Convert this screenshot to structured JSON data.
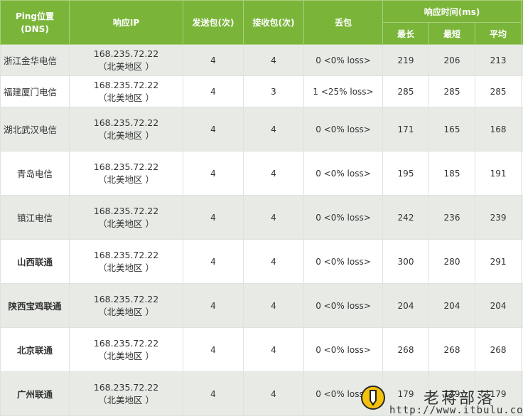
{
  "header": {
    "location": [
      "Ping位置",
      "(DNS)"
    ],
    "ip": "响应IP",
    "sent": "发送包(次)",
    "received": "接收包(次)",
    "lost": "丢包",
    "response_time": "响应时间(ms)",
    "max": "最长",
    "min": "最短",
    "avg": "平均"
  },
  "rows": [
    {
      "location": "浙江金华电信",
      "ip": "168.235.72.22",
      "region": "（北美地区 ）",
      "sent": "4",
      "received": "4",
      "lost": "0 <0% loss>",
      "max": "219",
      "min": "206",
      "avg": "213",
      "align": "left",
      "bold": false
    },
    {
      "location": "福建厦门电信",
      "ip": "168.235.72.22",
      "region": "（北美地区 ）",
      "sent": "4",
      "received": "3",
      "lost": "1 <25% loss>",
      "max": "285",
      "min": "285",
      "avg": "285",
      "align": "left",
      "bold": false
    },
    {
      "location": "湖北武汉电信",
      "ip": "168.235.72.22",
      "region": "（北美地区 ）",
      "sent": "4",
      "received": "4",
      "lost": "0 <0% loss>",
      "max": "171",
      "min": "165",
      "avg": "168",
      "align": "left",
      "bold": false
    },
    {
      "location": "青岛电信",
      "ip": "168.235.72.22",
      "region": "（北美地区 ）",
      "sent": "4",
      "received": "4",
      "lost": "0 <0% loss>",
      "max": "195",
      "min": "185",
      "avg": "191",
      "align": "center",
      "bold": false
    },
    {
      "location": "镇江电信",
      "ip": "168.235.72.22",
      "region": "（北美地区 ）",
      "sent": "4",
      "received": "4",
      "lost": "0 <0% loss>",
      "max": "242",
      "min": "236",
      "avg": "239",
      "align": "center",
      "bold": false
    },
    {
      "location": "山西联通",
      "ip": "168.235.72.22",
      "region": "（北美地区 ）",
      "sent": "4",
      "received": "4",
      "lost": "0 <0% loss>",
      "max": "300",
      "min": "280",
      "avg": "291",
      "align": "center",
      "bold": true
    },
    {
      "location": "陕西宝鸡联通",
      "ip": "168.235.72.22",
      "region": "（北美地区 ）",
      "sent": "4",
      "received": "4",
      "lost": "0 <0% loss>",
      "max": "204",
      "min": "204",
      "avg": "204",
      "align": "center",
      "bold": true
    },
    {
      "location": "北京联通",
      "ip": "168.235.72.22",
      "region": "（北美地区 ）",
      "sent": "4",
      "received": "4",
      "lost": "0 <0% loss>",
      "max": "268",
      "min": "268",
      "avg": "268",
      "align": "center",
      "bold": true
    },
    {
      "location": "广州联通",
      "ip": "168.235.72.22",
      "region": "（北美地区 ）",
      "sent": "4",
      "received": "4",
      "lost": "0 <0% loss>",
      "max": "179",
      "min": "179",
      "avg": "179",
      "align": "center",
      "bold": true
    }
  ],
  "watermark": {
    "title": "老蒋部落",
    "url": "http://www.itbulu.com",
    "icon": "pencil-logo-icon"
  },
  "colors": {
    "header_bg": "#7ab539",
    "odd_row_bg": "#e7eae5",
    "even_row_bg": "#ffffff"
  }
}
